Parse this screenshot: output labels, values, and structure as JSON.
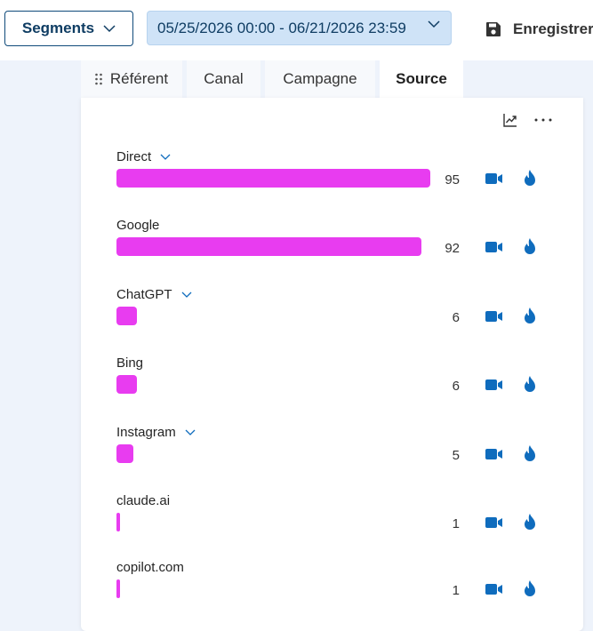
{
  "toolbar": {
    "segments_label": "Segments",
    "date_range": "05/25/2026 00:00 - 06/21/2026 23:59",
    "save_label": "Enregistrer"
  },
  "tabs": [
    {
      "label": "Référent",
      "active": false
    },
    {
      "label": "Canal",
      "active": false
    },
    {
      "label": "Campagne",
      "active": false
    },
    {
      "label": "Source",
      "active": true
    }
  ],
  "colors": {
    "bar": "#e83cf0",
    "accent": "#0f6cbd",
    "header_bg": "#cfe3f7"
  },
  "icons": [
    "chevron-down-icon",
    "save-icon",
    "drag-handle-icon",
    "trend-chart-icon",
    "more-icon",
    "video-camera-icon",
    "fire-icon"
  ],
  "sources": [
    {
      "label": "Direct",
      "value": "95",
      "expandable": true
    },
    {
      "label": "Google",
      "value": "92",
      "expandable": false
    },
    {
      "label": "ChatGPT",
      "value": "6",
      "expandable": true
    },
    {
      "label": "Bing",
      "value": "6",
      "expandable": false
    },
    {
      "label": "Instagram",
      "value": "5",
      "expandable": true
    },
    {
      "label": "claude.ai",
      "value": "1",
      "expandable": false
    },
    {
      "label": "copilot.com",
      "value": "1",
      "expandable": false
    }
  ]
}
